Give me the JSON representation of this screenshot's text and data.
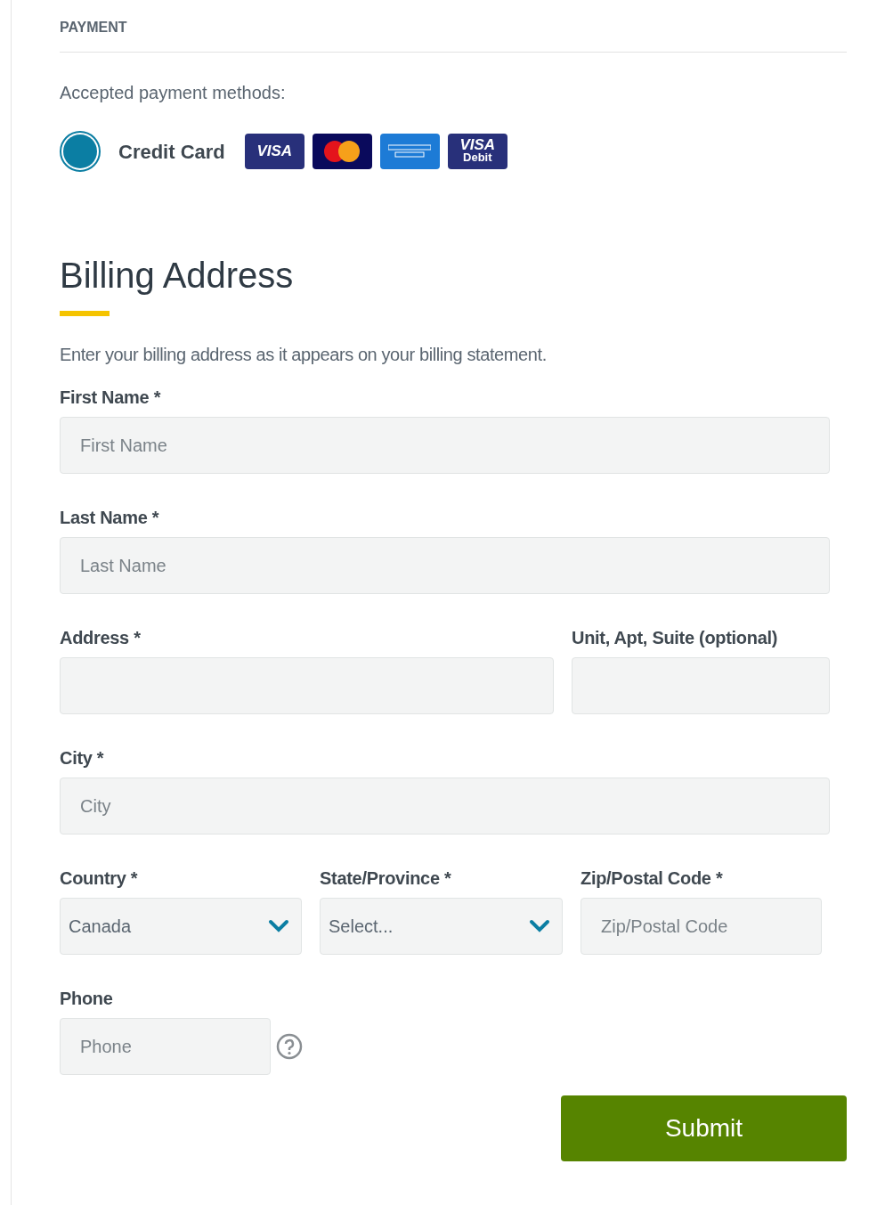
{
  "section_title": "PAYMENT",
  "methods_label": "Accepted payment methods:",
  "payment_option": {
    "label": "Credit Card",
    "selected": true
  },
  "cards": [
    {
      "kind": "visa",
      "lines": [
        "VISA"
      ]
    },
    {
      "kind": "mastercard"
    },
    {
      "kind": "amex"
    },
    {
      "kind": "visa",
      "lines": [
        "VISA",
        "Debit"
      ]
    }
  ],
  "heading": "Billing Address",
  "intro": "Enter your billing address as it appears on your billing statement.",
  "rows": [
    {
      "kind": "full",
      "fields": [
        {
          "kind": "text",
          "label": "First Name *",
          "placeholder": "First Name"
        }
      ]
    },
    {
      "kind": "full",
      "fields": [
        {
          "kind": "text",
          "label": "Last Name *",
          "placeholder": "Last Name"
        }
      ]
    },
    {
      "kind": "split",
      "fields": [
        {
          "kind": "text",
          "label": "Address *"
        },
        {
          "kind": "text",
          "label": "Unit, Apt, Suite (optional)"
        }
      ]
    },
    {
      "kind": "full",
      "fields": [
        {
          "kind": "text",
          "label": "City *",
          "placeholder": "City"
        }
      ]
    },
    {
      "kind": "thirds",
      "fields": [
        {
          "kind": "select",
          "label": "Country *",
          "value": "Canada"
        },
        {
          "kind": "select",
          "label": "State/Province *",
          "value": "Select..."
        },
        {
          "kind": "text",
          "label": "Zip/Postal Code *",
          "placeholder": "Zip/Postal Code"
        }
      ]
    },
    {
      "kind": "short",
      "fields": [
        {
          "kind": "phone",
          "label": "Phone",
          "placeholder": "Phone"
        }
      ]
    }
  ],
  "submit": "Submit"
}
